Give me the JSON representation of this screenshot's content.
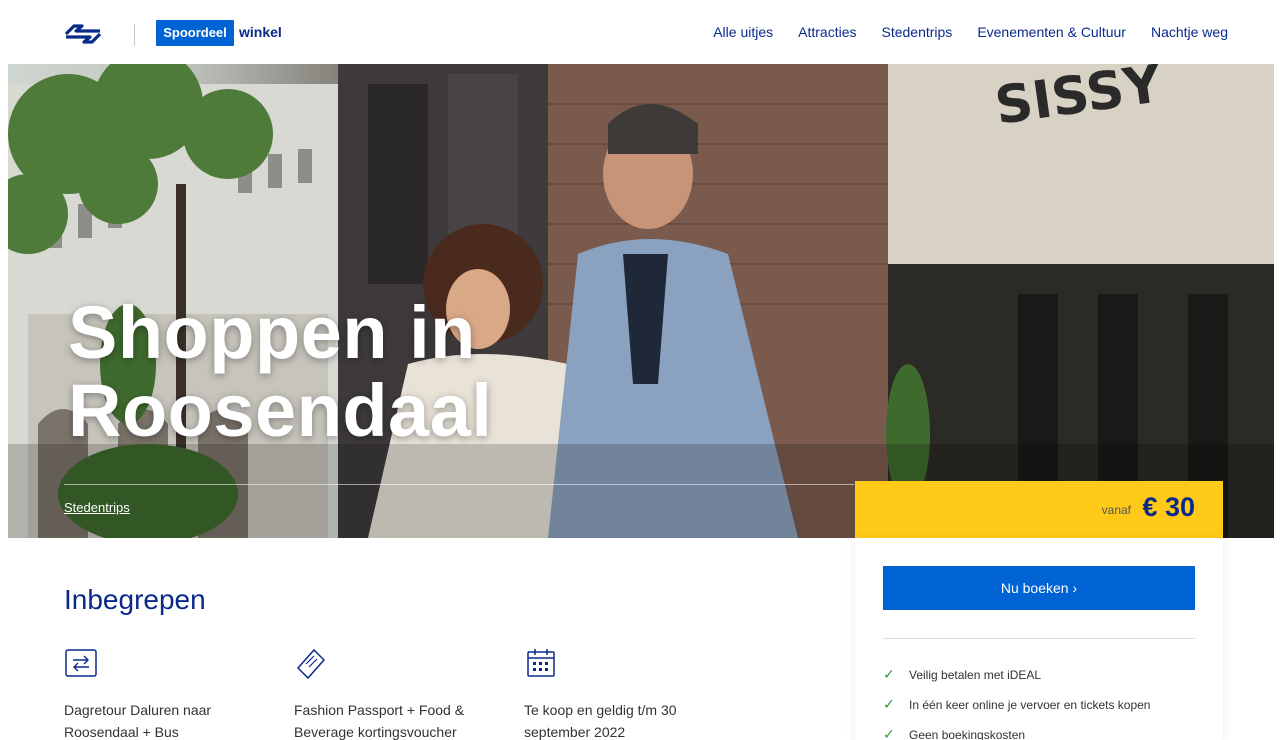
{
  "header": {
    "brand_label": "Spoordeel",
    "brand_word": "winkel",
    "nav": [
      "Alle uitjes",
      "Attracties",
      "Stedentrips",
      "Evenementen & Cultuur",
      "Nachtje weg"
    ]
  },
  "hero": {
    "title_line1": "Shoppen in",
    "title_line2": "Roosendaal",
    "tag": "Stedentrips"
  },
  "price": {
    "from": "vanaf",
    "value": "€ 30"
  },
  "booking": {
    "button": "Nu boeken ›",
    "usps": [
      "Veilig betalen met iDEAL",
      "In één keer online je vervoer en tickets kopen",
      "Geen boekingskosten"
    ]
  },
  "included": {
    "title": "Inbegrepen",
    "items": [
      {
        "icon": "transfer-icon",
        "text": "Dagretour Daluren naar Roosendaal + Bus"
      },
      {
        "icon": "ticket-icon",
        "text": "Fashion Passport + Food & Beverage kortingsvoucher"
      },
      {
        "icon": "calendar-icon",
        "text": "Te koop en geldig t/m 30 september 2022"
      }
    ]
  },
  "colors": {
    "brand_blue": "#0063d3",
    "navy": "#0a2a8a",
    "yellow": "#ffc917"
  }
}
